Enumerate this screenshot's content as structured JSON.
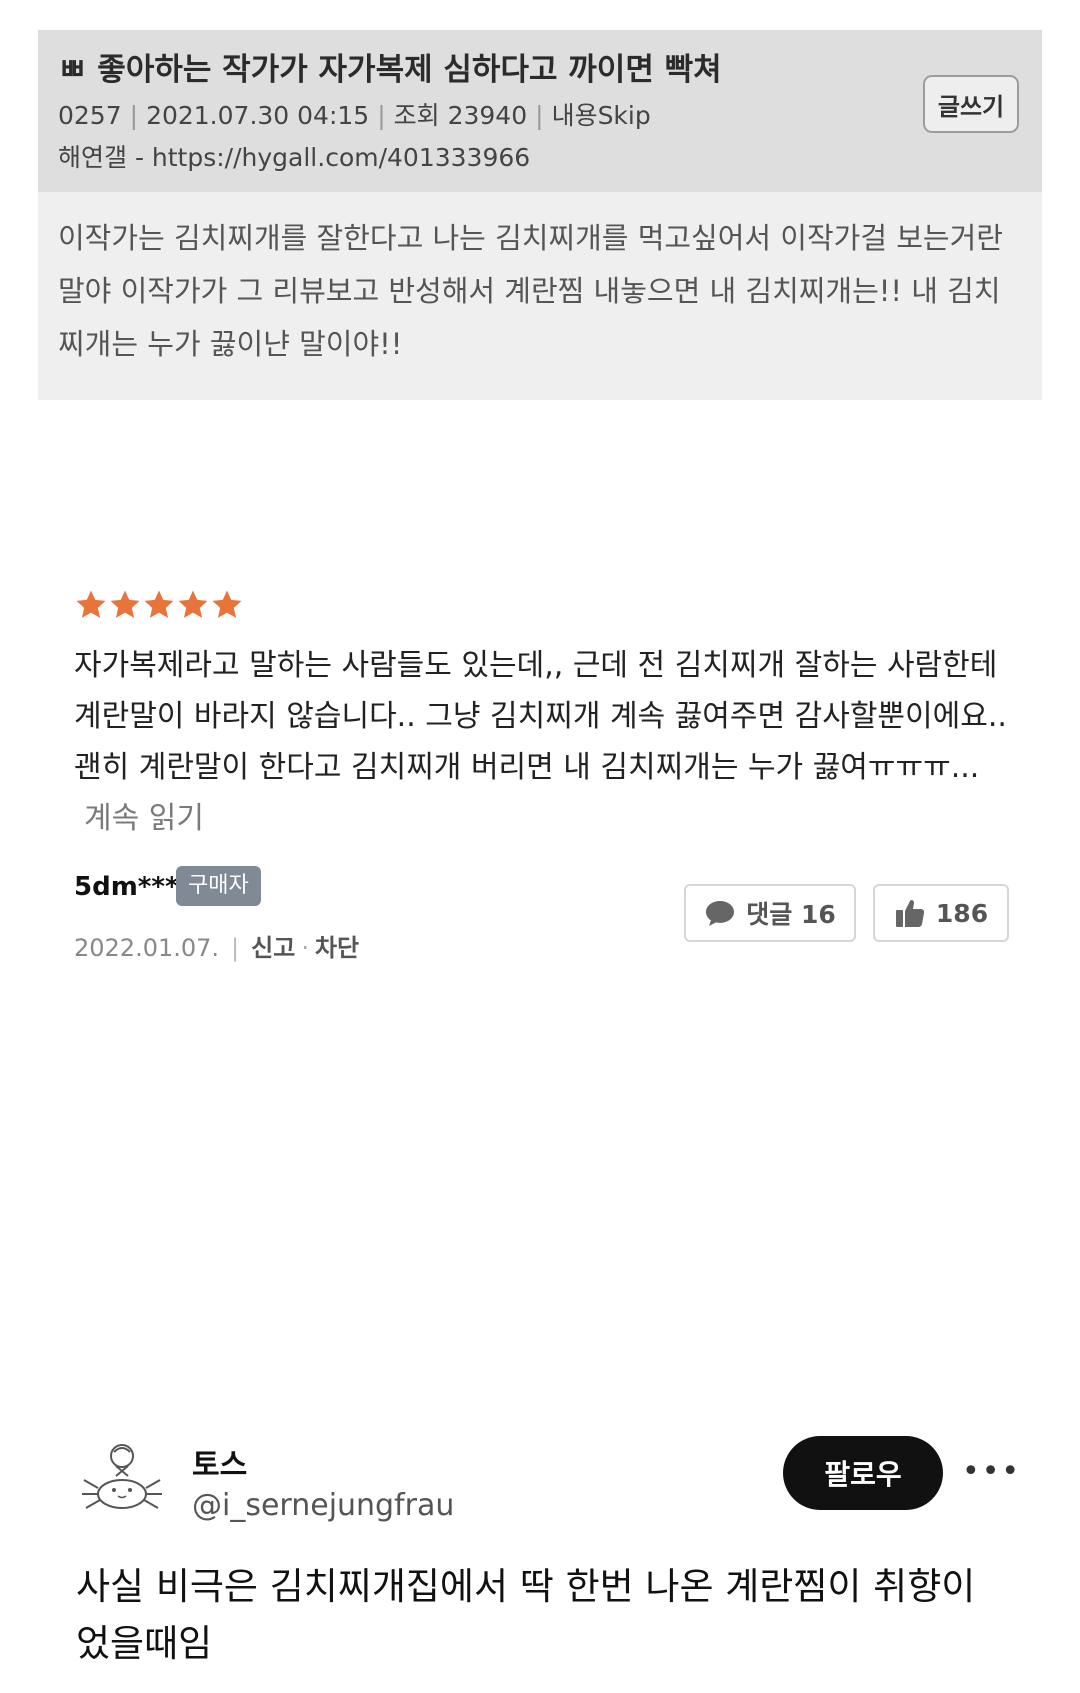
{
  "forum_post": {
    "title": "ㅃ 좋아하는 작가가 자가복제 심하다고 까이면 빡쳐",
    "post_number": "0257",
    "datetime": "2021.07.30 04:15",
    "views": "조회 23940",
    "skip_label": "내용Skip",
    "source": "해연갤 - https://hygall.com/401333966",
    "write_button_label": "글쓰기",
    "body": "이작가는 김치찌개를 잘한다고 나는 김치찌개를 먹고싶어서 이작가걸 보는거란말야 이작가가 그 리뷰보고 반성해서 계란찜 내놓으면 내 김치찌개는!! 내 김치찌개는 누가 끓이냔 말이야!!"
  },
  "review": {
    "rating": 5,
    "star_color": "#e8743b",
    "text": "자가복제라고 말하는 사람들도 있는데,, 근데 전 김치찌개 잘하는 사람한테 계란말이 바라지 않습니다.. 그냥 김치찌개 계속 끓여주면 감사할뿐이에요.. 괜히 계란말이 한다고 김치찌개 버리면 내 김치찌개는 누가 끓여ㅠㅠㅠ...",
    "read_more": "계속 읽기",
    "reviewer": "5dm***",
    "badge": "구매자",
    "date": "2022.01.07.",
    "report": "신고",
    "block": "차단",
    "comment_label": "댓글 16",
    "likes": "186"
  },
  "tweet": {
    "name": "토스",
    "handle": "@i_sernejungfrau",
    "follow_label": "팔로우",
    "more_label": "•••",
    "text": "사실 비극은 김치찌개집에서 딱 한번 나온 계란찜이 취향이었을때임"
  }
}
